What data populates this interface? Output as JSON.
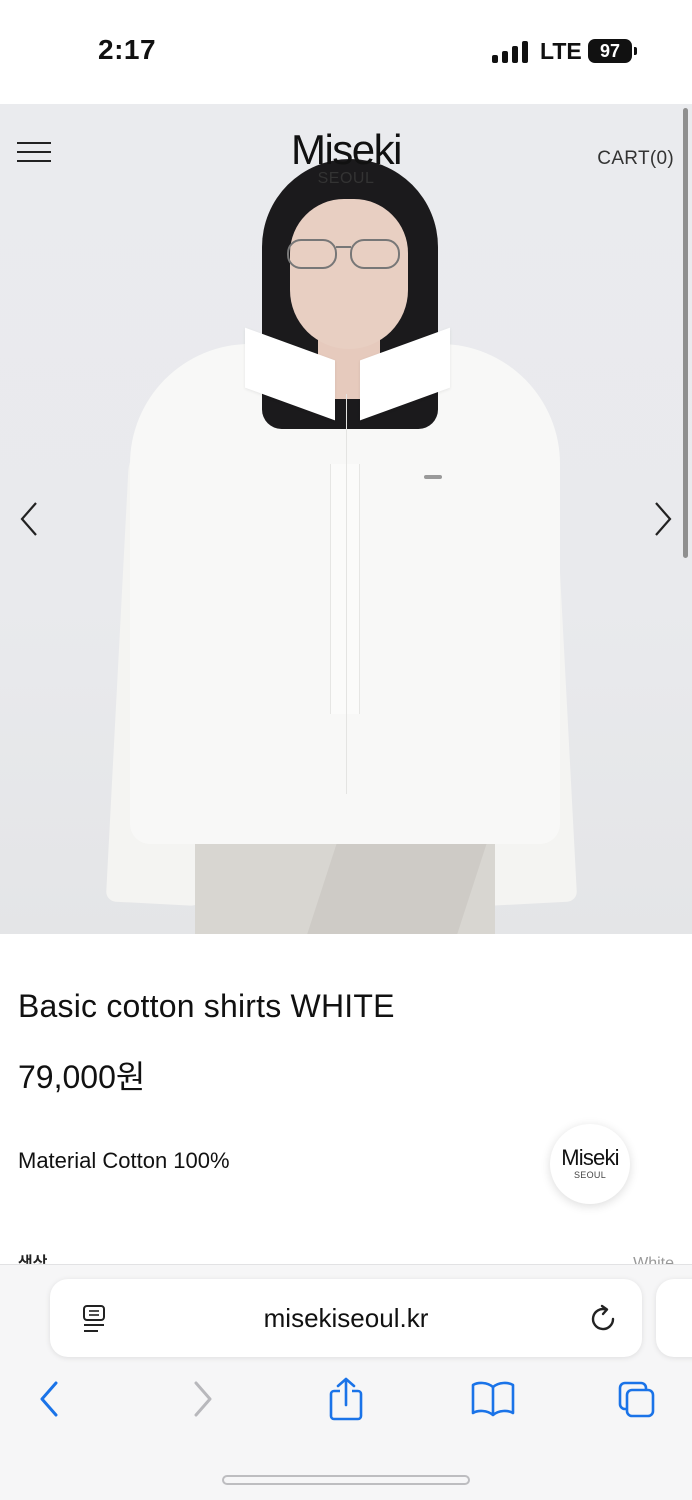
{
  "status_bar": {
    "time": "2:17",
    "network": "LTE",
    "battery": "97"
  },
  "header": {
    "brand_name": "Miseki",
    "brand_sub": "SEOUL",
    "cart": "CART(0)",
    "icons": {
      "menu": "hamburger-menu-icon",
      "prev": "chevron-left-icon",
      "next": "chevron-right-icon"
    }
  },
  "product": {
    "title": "Basic cotton shirts WHITE",
    "price": "79,000원",
    "material": "Material Cotton 100%",
    "option_label": "색상",
    "option_value": "White"
  },
  "floating_badge": {
    "name": "Miseki",
    "sub": "SEOUL"
  },
  "browser": {
    "url": "misekiseoul.kr",
    "icons": [
      "reader-icon",
      "reload-icon",
      "back-icon",
      "forward-icon",
      "share-icon",
      "bookmarks-icon",
      "tabs-icon"
    ]
  },
  "colors": {
    "accent": "#1a73e8",
    "hero_background": "#eaebee",
    "disabled": "#b8b8bc"
  }
}
